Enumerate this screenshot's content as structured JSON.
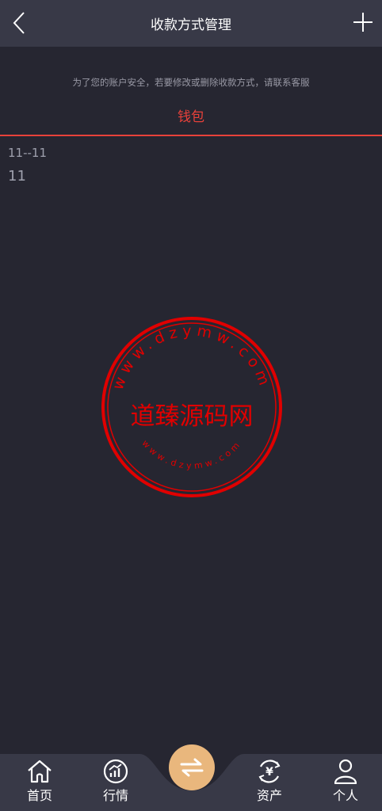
{
  "header": {
    "title": "收款方式管理",
    "back_icon": "chevron-left-icon",
    "add_icon": "plus-icon"
  },
  "notice": "为了您的账户安全，若要修改或删除收款方式，请联系客服",
  "tabs": [
    {
      "label": "钱包",
      "active": true
    }
  ],
  "accounts": [
    {
      "name": "11--11",
      "number": "11"
    }
  ],
  "watermark": {
    "top_text": "www.dzymw.com",
    "center_text": "道臻源码网",
    "bottom_text": "www.dzymw.com",
    "color": "#e00000"
  },
  "bottom_nav": {
    "items": [
      {
        "label": "首页",
        "icon": "home-icon"
      },
      {
        "label": "行情",
        "icon": "market-chart-icon"
      },
      {
        "label": "",
        "icon": "swap-arrows-icon"
      },
      {
        "label": "资产",
        "icon": "yuan-assets-icon"
      },
      {
        "label": "个人",
        "icon": "user-icon"
      }
    ]
  },
  "colors": {
    "background": "#262631",
    "header": "#383947",
    "accent": "#e8413a",
    "swap_button": "#e9b77d",
    "nav": "#383947"
  }
}
